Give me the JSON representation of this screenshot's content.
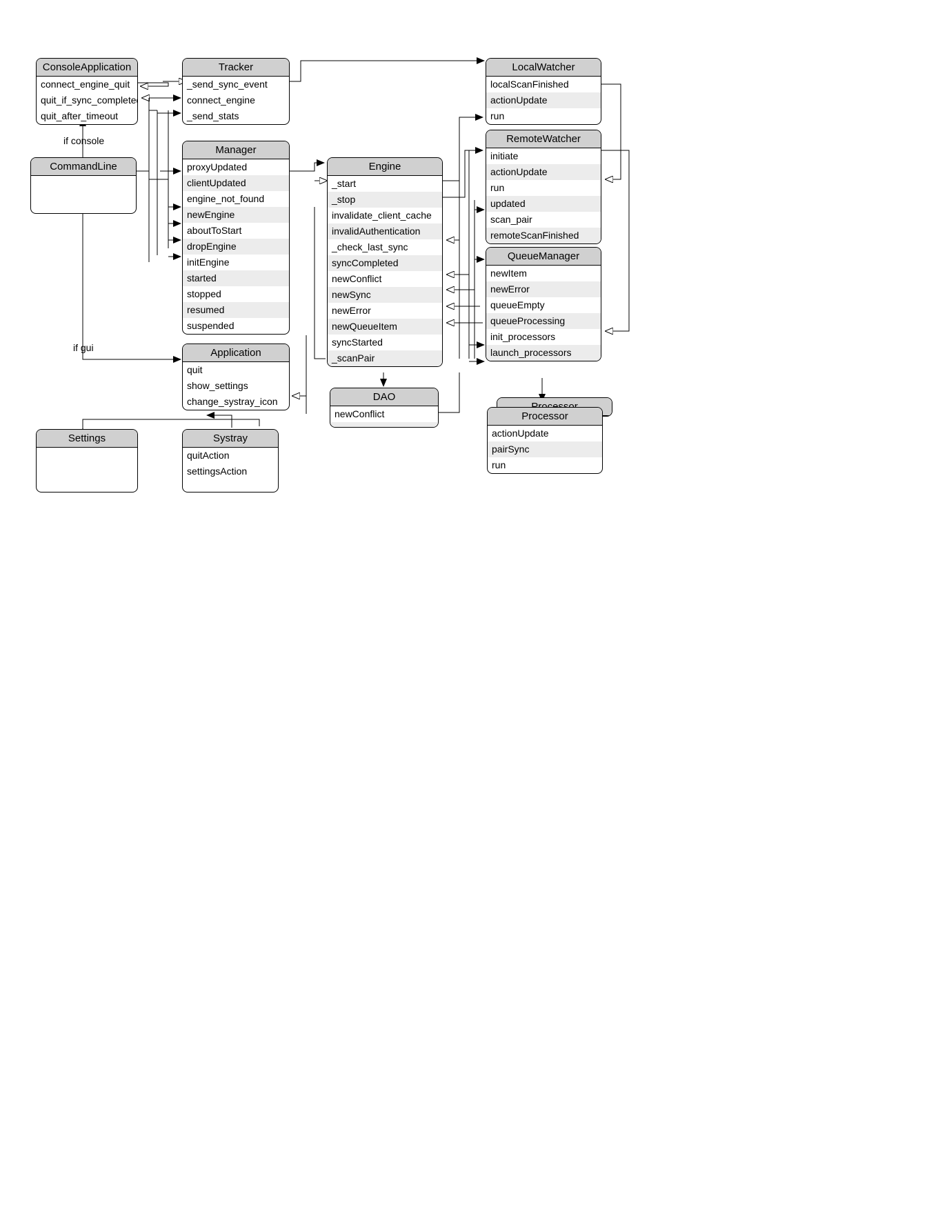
{
  "labels": {
    "if_console": "if console",
    "if_gui": "if gui"
  },
  "boxes": {
    "ConsoleApplication": {
      "title": "ConsoleApplication",
      "rows": [
        "connect_engine_quit",
        "quit_if_sync_completed",
        "quit_after_timeout"
      ]
    },
    "Tracker": {
      "title": "Tracker",
      "rows": [
        "_send_sync_event",
        "connect_engine",
        "_send_stats"
      ]
    },
    "CommandLine": {
      "title": "CommandLine",
      "rows": []
    },
    "Manager": {
      "title": "Manager",
      "rows": [
        "proxyUpdated",
        "clientUpdated",
        "engine_not_found",
        "newEngine",
        "aboutToStart",
        "dropEngine",
        "initEngine",
        "started",
        "stopped",
        "resumed",
        "suspended"
      ]
    },
    "Application": {
      "title": "Application",
      "rows": [
        "quit",
        "show_settings",
        "change_systray_icon"
      ]
    },
    "Settings": {
      "title": "Settings",
      "rows": []
    },
    "Systray": {
      "title": "Systray",
      "rows": [
        "quitAction",
        "settingsAction"
      ]
    },
    "Engine": {
      "title": "Engine",
      "rows": [
        "_start",
        "_stop",
        "invalidate_client_cache",
        "invalidAuthentication",
        "_check_last_sync",
        "syncCompleted",
        "newConflict",
        "newSync",
        "newError",
        "newQueueItem",
        "syncStarted",
        "_scanPair"
      ]
    },
    "DAO": {
      "title": "DAO",
      "rows": [
        "newConflict",
        ""
      ]
    },
    "LocalWatcher": {
      "title": "LocalWatcher",
      "rows": [
        "localScanFinished",
        "actionUpdate",
        "run"
      ]
    },
    "RemoteWatcher": {
      "title": "RemoteWatcher",
      "rows": [
        "initiate",
        "actionUpdate",
        "run",
        "updated",
        "scan_pair",
        "remoteScanFinished"
      ]
    },
    "QueueManager": {
      "title": "QueueManager",
      "rows": [
        "newItem",
        "newError",
        "queueEmpty",
        "queueProcessing",
        "init_processors",
        "launch_processors"
      ]
    },
    "ProcessorBack": {
      "title": "Processor",
      "rows": []
    },
    "Processor": {
      "title": "Processor",
      "rows": [
        "actionUpdate",
        "pairSync",
        "run"
      ]
    }
  }
}
